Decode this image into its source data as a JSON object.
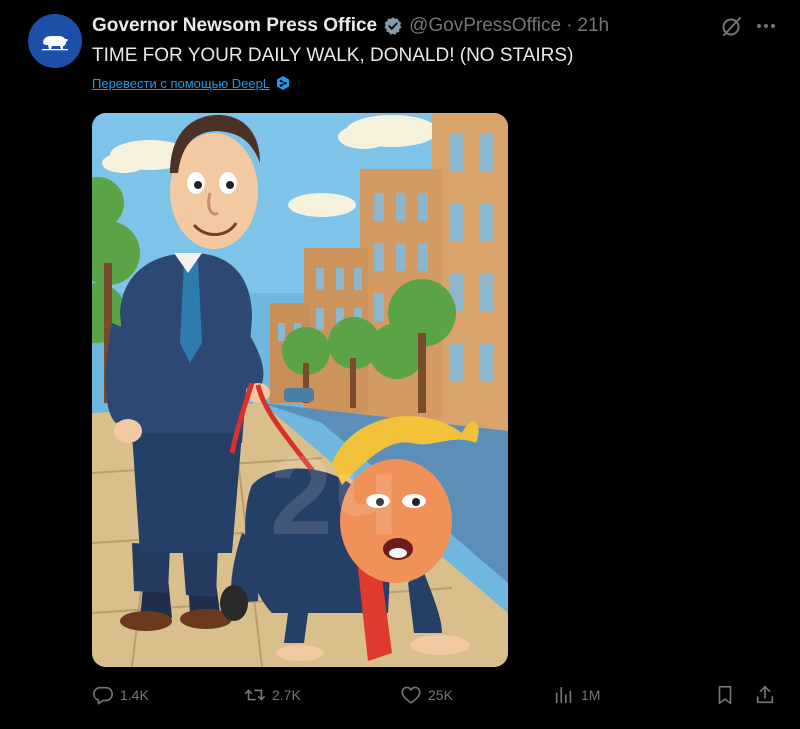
{
  "author": {
    "name": "Governor Newsom Press Office",
    "handle": "@GovPressOffice",
    "separator": "·",
    "time": "21h",
    "verified_color": "#829aab"
  },
  "tweet": {
    "text": "TIME FOR YOUR DAILY WALK, DONALD! (NO STAIRS)",
    "translate_label": "Перевести с помощью DeepL"
  },
  "media": {
    "watermark": "2ч"
  },
  "actions": {
    "replies": "1.4K",
    "reposts": "2.7K",
    "likes": "25K",
    "views": "1M"
  },
  "icons": [
    "bear-logo-icon",
    "verified-badge-icon",
    "grok-icon",
    "more-icon",
    "deepl-icon",
    "reply-icon",
    "repost-icon",
    "like-icon",
    "views-icon",
    "bookmark-icon",
    "share-icon"
  ],
  "colors": {
    "background": "#000000",
    "text": "#e7e9ea",
    "muted": "#71767b",
    "link": "#1d9bf0",
    "avatar_bg": "#1d4fa8"
  }
}
